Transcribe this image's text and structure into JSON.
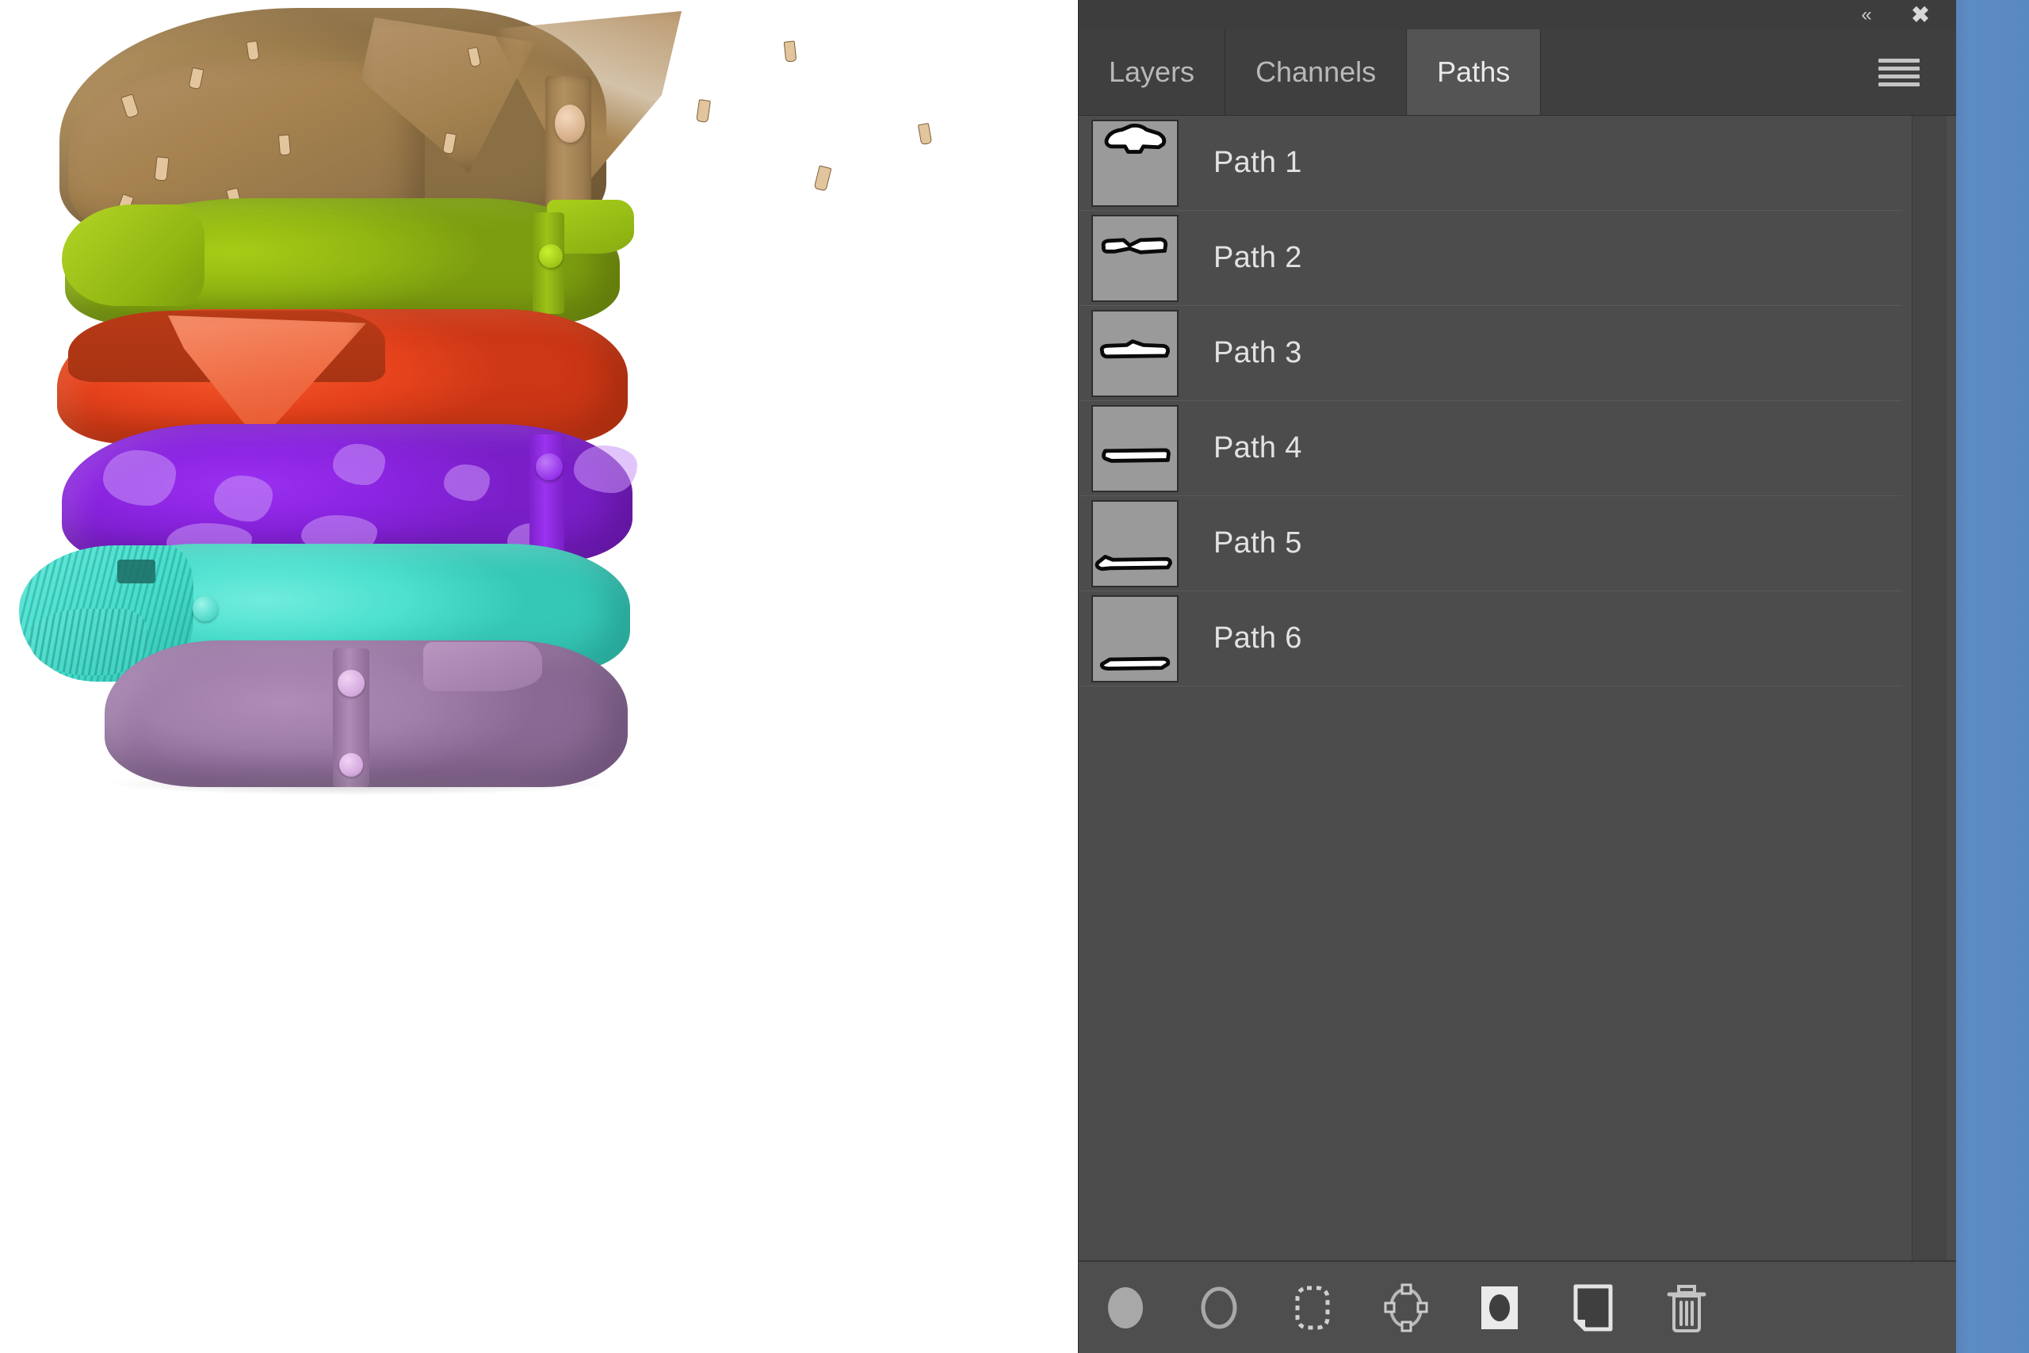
{
  "app": {
    "panel_title": "Paths",
    "accent_blue": "#5b8cc2",
    "panel_bg": "#4c4c4c",
    "tabbar_bg": "#3b3b3b",
    "active_tab_bg": "#545454",
    "thumb_bg": "#9a9a9a"
  },
  "titlebar": {
    "collapse_icon": "collapse-panel-icon",
    "collapse_glyph": "«",
    "close_icon": "close-panel-icon",
    "close_glyph": "✖"
  },
  "tabs": [
    {
      "label": "Layers",
      "active": false,
      "name": "tab-layers"
    },
    {
      "label": "Channels",
      "active": false,
      "name": "tab-channels"
    },
    {
      "label": "Paths",
      "active": true,
      "name": "tab-paths"
    }
  ],
  "menu": {
    "icon": "hamburger-menu-icon",
    "label": "Panel menu"
  },
  "paths": [
    {
      "label": "Path 1",
      "thumb_icon": "path-thumbnail-shirt-1"
    },
    {
      "label": "Path 2",
      "thumb_icon": "path-thumbnail-shirt-2"
    },
    {
      "label": "Path 3",
      "thumb_icon": "path-thumbnail-shirt-3"
    },
    {
      "label": "Path 4",
      "thumb_icon": "path-thumbnail-shirt-4"
    },
    {
      "label": "Path 5",
      "thumb_icon": "path-thumbnail-shirt-5"
    },
    {
      "label": "Path 6",
      "thumb_icon": "path-thumbnail-shirt-6"
    }
  ],
  "footer_buttons": [
    {
      "name": "fill-path-button",
      "icon": "filled-circle-icon",
      "label": "Fill path with foreground color"
    },
    {
      "name": "stroke-path-button",
      "icon": "circle-outline-icon",
      "label": "Stroke path with brush"
    },
    {
      "name": "load-path-as-selection-button",
      "icon": "dashed-selection-icon",
      "label": "Load path as a selection"
    },
    {
      "name": "make-work-path-button",
      "icon": "anchor-points-icon",
      "label": "Make work path from selection"
    },
    {
      "name": "add-layer-mask-button",
      "icon": "mask-icon",
      "label": "Add layer mask"
    },
    {
      "name": "create-new-path-button",
      "icon": "new-page-icon",
      "label": "Create new path"
    },
    {
      "name": "delete-path-button",
      "icon": "trash-icon",
      "label": "Delete current path"
    }
  ],
  "canvas": {
    "subject": "Stack of six folded shirts",
    "shirts": [
      {
        "order": 1,
        "color_name": "tan brown patterned",
        "hex": "#a5824f"
      },
      {
        "order": 2,
        "color_name": "lime green",
        "hex": "#8db411"
      },
      {
        "order": 3,
        "color_name": "orange red",
        "hex": "#e6441c"
      },
      {
        "order": 4,
        "color_name": "purple",
        "hex": "#8a24e0"
      },
      {
        "order": 5,
        "color_name": "turquoise cyan",
        "hex": "#48dfce"
      },
      {
        "order": 6,
        "color_name": "mauve purple",
        "hex": "#a380ad"
      }
    ],
    "background": "#ffffff"
  }
}
